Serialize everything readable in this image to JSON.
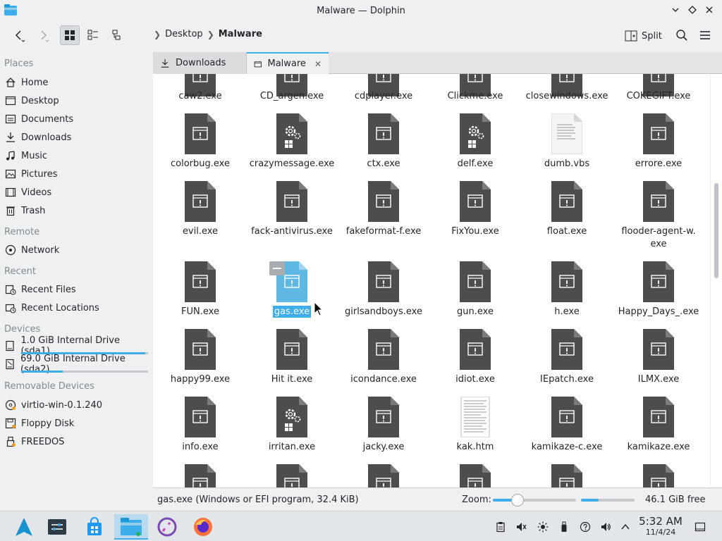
{
  "window": {
    "title": "Malware — Dolphin"
  },
  "toolbar": {
    "breadcrumb": [
      "Desktop",
      "Malware"
    ],
    "split_label": "Split"
  },
  "sidebar": {
    "places_header": "Places",
    "places": [
      {
        "label": "Home",
        "icon": "home-icon"
      },
      {
        "label": "Desktop",
        "icon": "desktop-icon"
      },
      {
        "label": "Documents",
        "icon": "documents-icon"
      },
      {
        "label": "Downloads",
        "icon": "downloads-icon"
      },
      {
        "label": "Music",
        "icon": "music-icon"
      },
      {
        "label": "Pictures",
        "icon": "pictures-icon"
      },
      {
        "label": "Videos",
        "icon": "videos-icon"
      },
      {
        "label": "Trash",
        "icon": "trash-icon"
      }
    ],
    "remote_header": "Remote",
    "remote": [
      {
        "label": "Network",
        "icon": "network-icon"
      }
    ],
    "recent_header": "Recent",
    "recent": [
      {
        "label": "Recent Files",
        "icon": "recent-files-icon"
      },
      {
        "label": "Recent Locations",
        "icon": "recent-locations-icon"
      }
    ],
    "devices_header": "Devices",
    "devices": [
      {
        "label": "1.0 GiB Internal Drive (sda1)",
        "icon": "drive-icon",
        "usage": 0.98
      },
      {
        "label": "69.0 GiB Internal Drive (sda2)",
        "icon": "drive-icon",
        "usage": 0.33
      }
    ],
    "removable_header": "Removable Devices",
    "removable": [
      {
        "label": "virtio-win-0.1.240",
        "icon": "optical-disc-icon"
      },
      {
        "label": "Floppy Disk",
        "icon": "floppy-icon"
      },
      {
        "label": "FREEDOS",
        "icon": "usb-drive-icon"
      }
    ]
  },
  "tabs": [
    {
      "label": "Downloads",
      "active": false
    },
    {
      "label": "Malware",
      "active": true
    }
  ],
  "files": [
    {
      "name": "caw2.exe",
      "type": "exe"
    },
    {
      "name": "CD_argen.exe",
      "type": "exe"
    },
    {
      "name": "cdplayer.exe",
      "type": "exe"
    },
    {
      "name": "Clickme.exe",
      "type": "exe"
    },
    {
      "name": "closewindows.exe",
      "type": "exe"
    },
    {
      "name": "COKEGIFT.exe",
      "type": "exe"
    },
    {
      "name": "colorbug.exe",
      "type": "exe"
    },
    {
      "name": "crazymessage.exe",
      "type": "gear"
    },
    {
      "name": "ctx.exe",
      "type": "exe"
    },
    {
      "name": "delf.exe",
      "type": "gear"
    },
    {
      "name": "dumb.vbs",
      "type": "text"
    },
    {
      "name": "errore.exe",
      "type": "exe"
    },
    {
      "name": "evil.exe",
      "type": "exe"
    },
    {
      "name": "fack-antivirus.exe",
      "type": "exe"
    },
    {
      "name": "fakeformat-f.exe",
      "type": "exe"
    },
    {
      "name": "FixYou.exe",
      "type": "exe"
    },
    {
      "name": "float.exe",
      "type": "exe"
    },
    {
      "name": "flooder-agent-w.",
      "name2": "exe",
      "type": "exe"
    },
    {
      "name": "FUN.exe",
      "type": "exe"
    },
    {
      "name": "gas.exe",
      "type": "exe",
      "selected": true
    },
    {
      "name": "girlsandboys.exe",
      "type": "exe"
    },
    {
      "name": "gun.exe",
      "type": "exe"
    },
    {
      "name": "h.exe",
      "type": "exe"
    },
    {
      "name": "Happy_Days_.exe",
      "type": "exe"
    },
    {
      "name": "happy99.exe",
      "type": "exe"
    },
    {
      "name": "Hit it.exe",
      "type": "exe"
    },
    {
      "name": "icondance.exe",
      "type": "exe"
    },
    {
      "name": "idiot.exe",
      "type": "exe"
    },
    {
      "name": "IEpatch.exe",
      "type": "exe"
    },
    {
      "name": "ILMX.exe",
      "type": "exe"
    },
    {
      "name": "info.exe",
      "type": "exe"
    },
    {
      "name": "irritan.exe",
      "type": "gear"
    },
    {
      "name": "jacky.exe",
      "type": "exe"
    },
    {
      "name": "kak.htm",
      "type": "html"
    },
    {
      "name": "kamikaze-c.exe",
      "type": "exe"
    },
    {
      "name": "kamikaze.exe",
      "type": "exe"
    }
  ],
  "status": {
    "selection_text": "gas.exe (Windows or EFI program, 32.4 KiB)",
    "zoom_label": "Zoom:",
    "zoom_level": 0.3,
    "free_label": "46.1 GiB free",
    "disk_usage": 0.33
  },
  "taskbar": {
    "time": "5:32 AM",
    "date": "11/4/24"
  },
  "colors": {
    "accent": "#3daee9",
    "exe_icon": "#4d4d4d",
    "selection": "#3daee9"
  }
}
